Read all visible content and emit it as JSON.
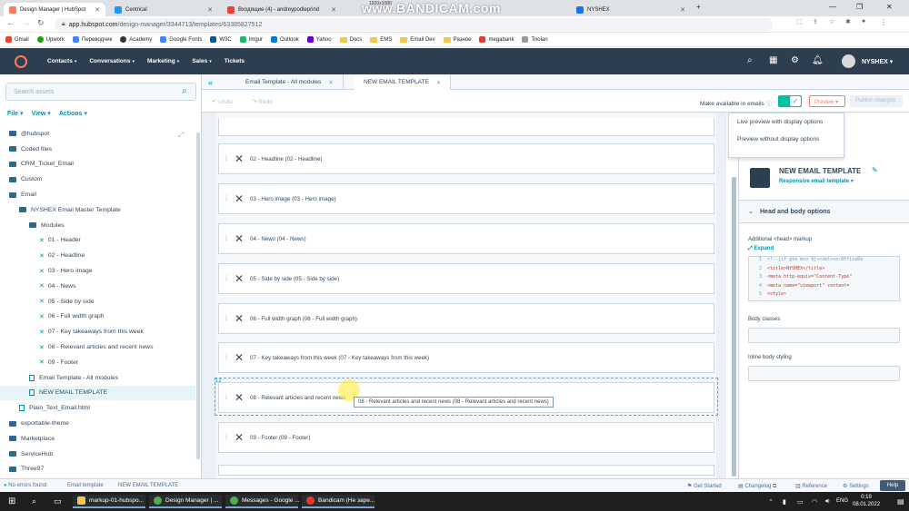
{
  "browser": {
    "tabs": [
      {
        "title": "Design Manager | HubSpot",
        "color": "#ff7a59"
      },
      {
        "title": "Centrical",
        "color": "#2196f3"
      },
      {
        "title": "Входящие (4) - andreypodleprind",
        "color": "#ea4335"
      },
      {
        "title": "NYSHEX",
        "color": "#1a73e8"
      }
    ],
    "watermark": "www.BANDICAM.com",
    "resolution": "1920x1080",
    "url_host": "app.hubspot.com",
    "url_path": "/design-manager/3344713/templates/63385827512",
    "bookmarks": [
      "Gmail",
      "Upwork",
      "Переводчик",
      "Academy",
      "Google Fonts",
      "W3C",
      "Imgur",
      "Outlook",
      "Yahoo",
      "Docs",
      "EMS",
      "Email Dev",
      "Разное",
      "megabank",
      "Triolan"
    ]
  },
  "hubspot_nav": {
    "items": [
      "Contacts",
      "Conversations",
      "Marketing",
      "Sales",
      "Tickets"
    ],
    "account": "NYSHEX"
  },
  "sidebar": {
    "search_placeholder": "Search assets",
    "file_menu": "File",
    "view_menu": "View",
    "actions_menu": "Actions",
    "tree": [
      {
        "label": "@hubspot",
        "type": "folder",
        "indent": 0
      },
      {
        "label": "Coded files",
        "type": "folder",
        "indent": 0
      },
      {
        "label": "CRM_Ticket_Email",
        "type": "folder",
        "indent": 0
      },
      {
        "label": "Custom",
        "type": "folder",
        "indent": 0
      },
      {
        "label": "Email",
        "type": "folder",
        "indent": 0
      },
      {
        "label": "NYSHEX Email Master Template",
        "type": "folder",
        "indent": 1
      },
      {
        "label": "Modules",
        "type": "folder",
        "indent": 2
      },
      {
        "label": "01 - Header",
        "type": "module",
        "indent": 3
      },
      {
        "label": "02 - Headline",
        "type": "module",
        "indent": 3
      },
      {
        "label": "03 - Hero image",
        "type": "module",
        "indent": 3
      },
      {
        "label": "04 - News",
        "type": "module",
        "indent": 3
      },
      {
        "label": "05 - Side by side",
        "type": "module",
        "indent": 3
      },
      {
        "label": "06 - Full width graph",
        "type": "module",
        "indent": 3
      },
      {
        "label": "07 - Key takeaways from this week",
        "type": "module",
        "indent": 3
      },
      {
        "label": "08 - Relevant articles and recent news",
        "type": "module",
        "indent": 3
      },
      {
        "label": "09 - Footer",
        "type": "module",
        "indent": 3
      },
      {
        "label": "Email Template - All modules",
        "type": "doc",
        "indent": 2
      },
      {
        "label": "NEW EMAIL TEMPLATE",
        "type": "doc",
        "indent": 2,
        "selected": true
      },
      {
        "label": "Plain_Text_Email.html",
        "type": "doc",
        "indent": 1
      },
      {
        "label": "exportable-theme",
        "type": "folder",
        "indent": 0
      },
      {
        "label": "Marketplace",
        "type": "folder",
        "indent": 0
      },
      {
        "label": "ServiceHub",
        "type": "folder",
        "indent": 0
      },
      {
        "label": "Three97",
        "type": "folder",
        "indent": 0
      }
    ]
  },
  "editor": {
    "tabs": [
      "Email Template - All modules",
      "NEW EMAIL TEMPLATE"
    ],
    "undo": "Undo",
    "redo": "Redo",
    "make_available": "Make available in emails",
    "preview_btn": "Preview",
    "publish_btn": "Publish changes",
    "preview_options": [
      "Live preview with display options",
      "Preview without display options"
    ],
    "modules": [
      "02 - Headline (02 - Headline)",
      "03 - Hero image (03 - Hero image)",
      "04 - News (04 - News)",
      "05 - Side by side (05 - Side by side)",
      "06 - Full width graph (06 - Full width graph)",
      "07 - Key takeaways from this week (07 - Key takeaways from this week)",
      "08 - Relevant articles and recent news",
      "09 - Footer (09 - Footer)"
    ],
    "row_number": "12",
    "tooltip": "08 - Relevant articles and recent news (08 - Relevant articles and recent news)"
  },
  "right_panel": {
    "template_name": "NEW EMAIL TEMPLATE",
    "template_type": "Responsive email template",
    "section": "Head and body options",
    "head_markup_label": "Additional <head> markup",
    "expand": "Expand",
    "code_lines": [
      {
        "n": "1",
        "code": "<!--[if gte mso 9]><xml><o:OfficeDo"
      },
      {
        "n": "2",
        "code": "<title>NYSHEX</title>"
      },
      {
        "n": "3",
        "code": "<meta http-equiv=\"Content-Type\""
      },
      {
        "n": "4",
        "code": "<meta name=\"viewport\" content="
      },
      {
        "n": "5",
        "code": "<style>"
      }
    ],
    "body_classes_label": "Body classes",
    "inline_body_label": "Inline body styling"
  },
  "status_bar": {
    "errors": "No errors found",
    "type": "Email template",
    "name": "NEW EMAIL TEMPLATE",
    "get_started": "Get Started",
    "changelog": "Changelog",
    "reference": "Reference",
    "settings": "Settings",
    "help": "Help"
  },
  "taskbar": {
    "apps": [
      "markup-01-hubspo...",
      "Design Manager | ...",
      "Messages - Google ...",
      "Bandicam (Не заре..."
    ],
    "lang": "ENG",
    "time": "0:19",
    "date": "08.01.2022"
  }
}
